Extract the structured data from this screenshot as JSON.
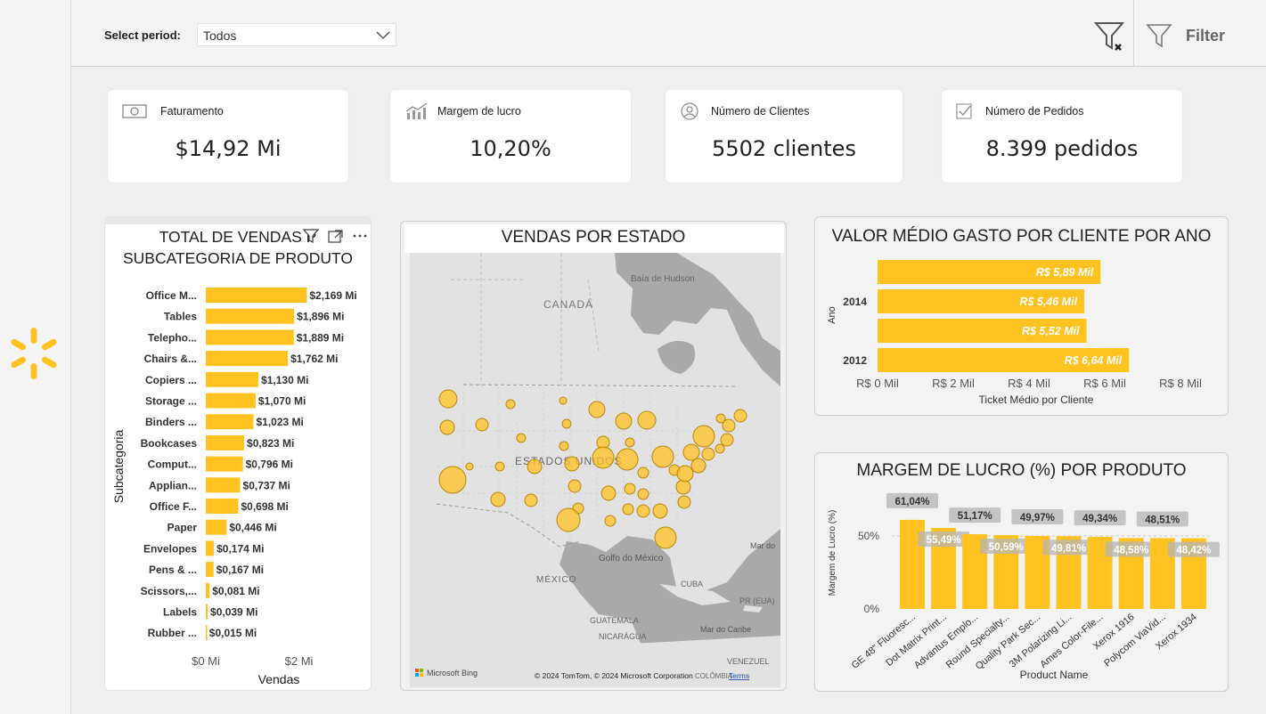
{
  "header": {
    "period_label": "Select period:",
    "period_value": "Todos",
    "filter_label": "Filter"
  },
  "kpis": [
    {
      "label": "Faturamento",
      "value": "$14,92 Mi",
      "icon": "money-icon"
    },
    {
      "label": "Margem de lucro",
      "value": "10,20%",
      "icon": "growth-chart-icon"
    },
    {
      "label": "Número de Clientes",
      "value": "5502 clientes",
      "icon": "user-icon"
    },
    {
      "label": "Número de Pedidos",
      "value": "8.399 pedidos",
      "icon": "checkbox-icon"
    }
  ],
  "vendas_sub": {
    "title_line1": "TOTAL DE VENDAS P",
    "title_line2": "SUBCATEGORIA DE PRODUTO"
  },
  "mapa": {
    "title": "VENDAS POR ESTADO",
    "labels": {
      "canada": "CANADÁ",
      "bay": "Baía de Hudson",
      "usa": "ESTADOS UNIDOS",
      "gulf": "Golfo do México",
      "mexico": "MÉXICO",
      "cuba": "CUBA",
      "pr": "PR (EUA)",
      "guatemala": "GUATEMALA",
      "nicaragua": "NICARÁGUA",
      "caribbean": "Mar do Caribe",
      "sea": "Mar do",
      "venezuela": "VENEZUEL",
      "colombia": "COLÔMBIA"
    },
    "bing": "Microsoft Bing",
    "copyright": "© 2024 TomTom, © 2024 Microsoft Corporation",
    "terms": "Terms"
  },
  "valor_medio": {
    "title": "VALOR MÉDIO GASTO POR CLIENTE POR ANO"
  },
  "margem_produto": {
    "title": "MARGEM DE LUCRO (%) POR PRODUTO"
  },
  "chart_data": [
    {
      "type": "bar",
      "orientation": "horizontal",
      "title": "TOTAL DE VENDAS POR SUBCATEGORIA DE PRODUTO",
      "xlabel": "Vendas",
      "ylabel": "Subcategoria",
      "xlim": [
        0,
        2.2
      ],
      "x_ticks": [
        "$0 Mi",
        "$2 Mi"
      ],
      "categories": [
        "Office M...",
        "Tables",
        "Telepho...",
        "Chairs &...",
        "Copiers ...",
        "Storage ...",
        "Binders ...",
        "Bookcases",
        "Comput...",
        "Applian...",
        "Office F...",
        "Paper",
        "Envelopes",
        "Pens & ...",
        "Scissors,...",
        "Labels",
        "Rubber ..."
      ],
      "values": [
        2.169,
        1.896,
        1.889,
        1.762,
        1.13,
        1.07,
        1.023,
        0.823,
        0.796,
        0.737,
        0.698,
        0.446,
        0.174,
        0.167,
        0.081,
        0.039,
        0.015
      ],
      "data_labels": [
        "$2,169 Mi",
        "$1,896 Mi",
        "$1,889 Mi",
        "$1,762 Mi",
        "$1,130 Mi",
        "$1,070 Mi",
        "$1,023 Mi",
        "$0,823 Mi",
        "$0,796 Mi",
        "$0,737 Mi",
        "$0,698 Mi",
        "$0,446 Mi",
        "$0,174 Mi",
        "$0,167 Mi",
        "$0,081 Mi",
        "$0,039 Mi",
        "$0,015 Mi"
      ],
      "color": "#FFC220"
    },
    {
      "type": "bar",
      "orientation": "horizontal",
      "title": "VALOR MÉDIO GASTO POR CLIENTE POR ANO",
      "xlabel": "Ticket Médio por Cliente",
      "ylabel": "Ano",
      "xlim": [
        0,
        8
      ],
      "x_ticks": [
        "R$ 0 Mil",
        "R$ 2 Mil",
        "R$ 4 Mil",
        "R$ 6 Mil",
        "R$ 8 Mil"
      ],
      "categories": [
        "",
        "2014",
        "",
        "2012"
      ],
      "values": [
        5.89,
        5.46,
        5.52,
        6.64
      ],
      "data_labels": [
        "R$ 5,89 Mil",
        "R$ 5,46 Mil",
        "R$ 5,52 Mil",
        "R$ 6,64 Mil"
      ],
      "color": "#FFC220"
    },
    {
      "type": "bar",
      "title": "MARGEM DE LUCRO (%) POR PRODUTO",
      "xlabel": "Product Name",
      "ylabel": "Margem de Lucro (%)",
      "ylim": [
        0,
        75
      ],
      "y_ticks": [
        "0%",
        "50%"
      ],
      "categories": [
        "GE 48\" Fluoresc...",
        "Dot Matrix Print...",
        "Advantus Emplo...",
        "Round Specialty...",
        "Quality Park Sec...",
        "3M Polarizing Li...",
        "Ames Color-File...",
        "Xerox 1916",
        "Polycom ViaVid...",
        "Xerox 1934"
      ],
      "values": [
        61.04,
        55.49,
        51.17,
        50.59,
        49.97,
        49.81,
        49.34,
        48.58,
        48.51,
        48.42
      ],
      "data_labels": [
        "61,04%",
        "55,49%",
        "51,17%",
        "50,59%",
        "49,97%",
        "49,81%",
        "49,34%",
        "48,58%",
        "48,51%",
        "48,42%"
      ],
      "color": "#FFC220"
    },
    {
      "type": "scatter",
      "title": "VENDAS POR ESTADO",
      "note": "bubble map of US states"
    }
  ]
}
